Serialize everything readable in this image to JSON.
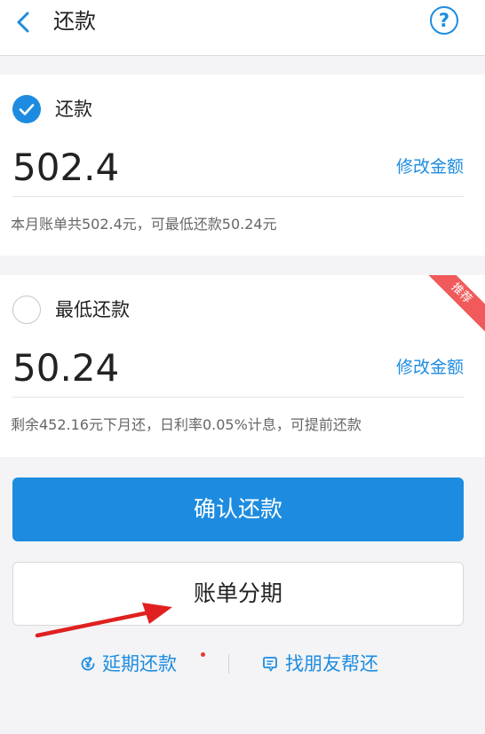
{
  "header": {
    "title": "还款",
    "back_icon": "chevron-left-icon",
    "help_icon": "question-circle-icon",
    "help_symbol": "?",
    "accent_color": "#1d8ce0"
  },
  "options": [
    {
      "label": "还款",
      "selected": true,
      "amount": "502.4",
      "modify_label": "修改金额",
      "note": "本月账单共502.4元，可最低还款50.24元"
    },
    {
      "label": "最低还款",
      "selected": false,
      "amount": "50.24",
      "modify_label": "修改金额",
      "note": "剩余452.16元下月还，日利率0.05%计息，可提前还款",
      "badge": "推荐",
      "badge_color": "#f05a5a"
    }
  ],
  "actions": {
    "confirm_label": "确认还款",
    "installment_label": "账单分期"
  },
  "links": {
    "defer_label": "延期还款",
    "defer_icon": "yen-circle-icon",
    "friend_label": "找朋友帮还",
    "friend_icon": "chat-icon"
  },
  "annotation": {
    "arrow_color": "#e02020"
  }
}
